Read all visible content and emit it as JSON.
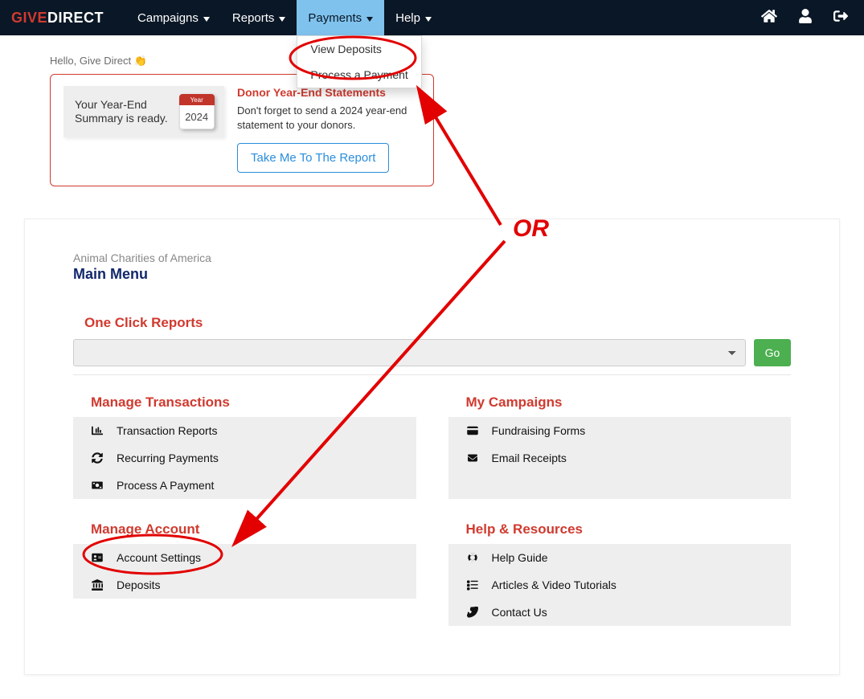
{
  "brand": {
    "part1": "GIVE",
    "part2": "DIRECT"
  },
  "nav": {
    "items": [
      {
        "label": "Campaigns"
      },
      {
        "label": "Reports"
      },
      {
        "label": "Payments"
      },
      {
        "label": "Help"
      }
    ],
    "payments_dropdown": [
      "View Deposits",
      "Process a Payment"
    ]
  },
  "greeting": "Hello, Give Direct 👏",
  "alert": {
    "card_line1": "Your Year-End",
    "card_line2": "Summary is ready.",
    "cal_top": "Year",
    "cal_year": "2024",
    "title": "Donor Year-End Statements",
    "body": "Don't forget to send a 2024 year-end statement to your donors.",
    "button": "Take Me To The Report"
  },
  "org_name": "Animal Charities of America",
  "page_title": "Main Menu",
  "one_click_reports": {
    "title": "One Click Reports",
    "go": "Go"
  },
  "sections": {
    "manage_transactions": {
      "title": "Manage Transactions",
      "items": [
        "Transaction Reports",
        "Recurring Payments",
        "Process A Payment"
      ]
    },
    "manage_account": {
      "title": "Manage Account",
      "items": [
        "Account Settings",
        "Deposits"
      ]
    },
    "my_campaigns": {
      "title": "My Campaigns",
      "items": [
        "Fundraising Forms",
        "Email Receipts"
      ]
    },
    "help_resources": {
      "title": "Help & Resources",
      "items": [
        "Help Guide",
        "Articles & Video Tutorials",
        "Contact Us"
      ]
    }
  },
  "annotation": {
    "or": "OR"
  }
}
